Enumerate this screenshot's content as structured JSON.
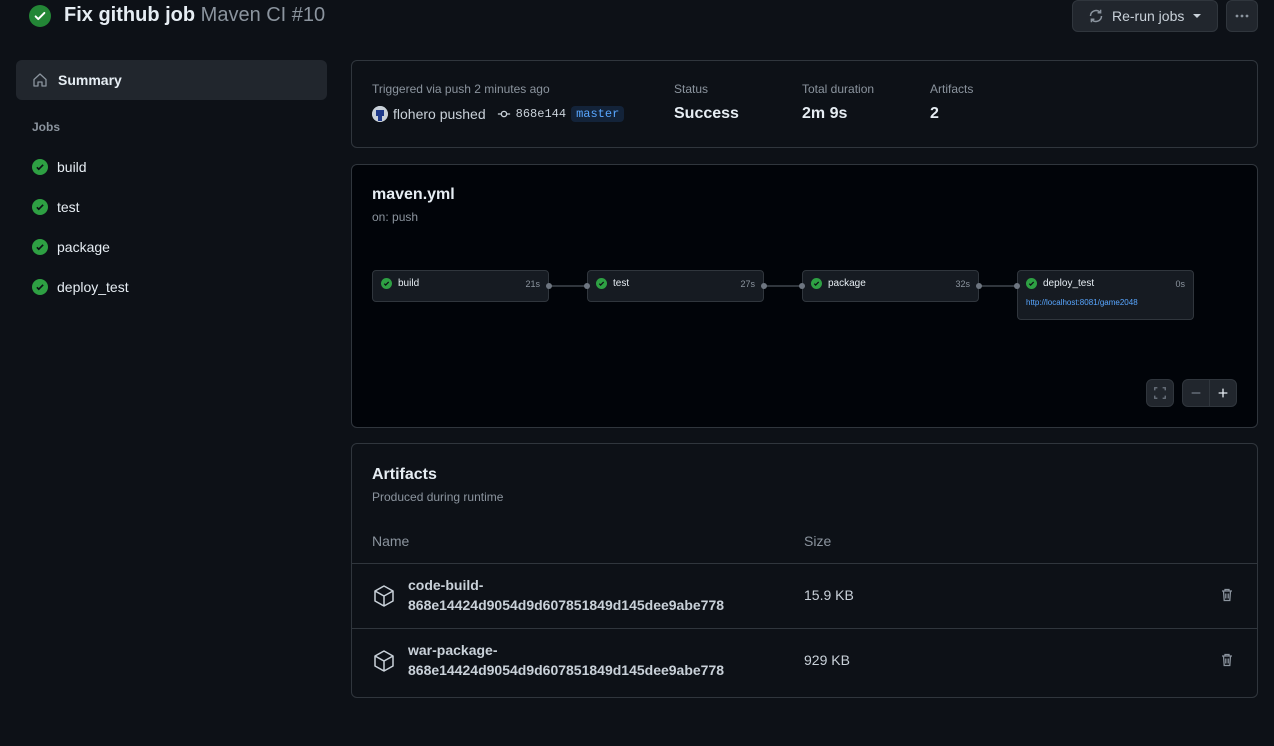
{
  "header": {
    "title": "Fix github job",
    "subtitle": "Maven CI #10",
    "rerun_label": "Re-run jobs"
  },
  "sidebar": {
    "summary_label": "Summary",
    "jobs_heading": "Jobs",
    "jobs": [
      {
        "label": "build"
      },
      {
        "label": "test"
      },
      {
        "label": "package"
      },
      {
        "label": "deploy_test"
      }
    ]
  },
  "run_info": {
    "trigger_label": "Triggered via push 2 minutes ago",
    "actor_text": "flohero pushed",
    "commit": "868e144",
    "branch": "master",
    "status_label": "Status",
    "status_value": "Success",
    "duration_label": "Total duration",
    "duration_value": "2m 9s",
    "artifacts_label": "Artifacts",
    "artifacts_value": "2"
  },
  "workflow": {
    "file": "maven.yml",
    "trigger": "on: push",
    "jobs": [
      {
        "name": "build",
        "time": "21s"
      },
      {
        "name": "test",
        "time": "27s"
      },
      {
        "name": "package",
        "time": "32s"
      },
      {
        "name": "deploy_test",
        "time": "0s",
        "link": "http://localhost:8081/game2048"
      }
    ]
  },
  "artifacts": {
    "title": "Artifacts",
    "subtitle": "Produced during runtime",
    "col_name": "Name",
    "col_size": "Size",
    "items": [
      {
        "name_line1": "code-build-",
        "name_line2": "868e14424d9054d9d607851849d145dee9abe778",
        "size": "15.9 KB"
      },
      {
        "name_line1": "war-package-",
        "name_line2": "868e14424d9054d9d607851849d145dee9abe778",
        "size": "929 KB"
      }
    ]
  },
  "colors": {
    "success": "#2ea043",
    "link": "#58a6ff",
    "background": "#0d1117",
    "border": "#30363d"
  }
}
